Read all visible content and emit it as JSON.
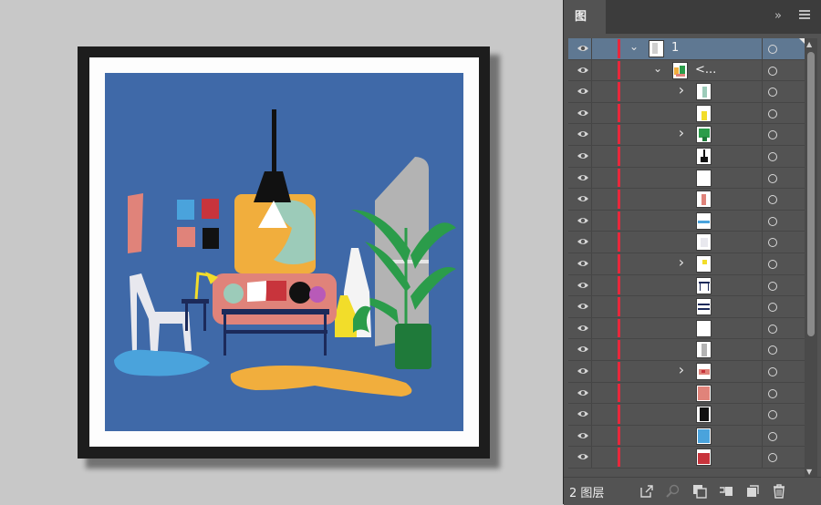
{
  "panel": {
    "tab_label": "图层",
    "layer_count_label": "2 图层",
    "colors": {
      "selected_row": "#5f7892",
      "layer_color_bar": "#e8283c",
      "panel_bg": "#535353"
    }
  },
  "layers": [
    {
      "name": "1",
      "indent": 0,
      "chevron": "down",
      "selected": true,
      "thumb": "artboard"
    },
    {
      "name": "<...",
      "indent": 1,
      "chevron": "down",
      "selected": false,
      "thumb": "group"
    },
    {
      "name": "",
      "indent": 2,
      "chevron": "right",
      "selected": false,
      "thumb": "teal-figure"
    },
    {
      "name": "",
      "indent": 2,
      "chevron": "",
      "selected": false,
      "thumb": "yellow-vase"
    },
    {
      "name": "",
      "indent": 2,
      "chevron": "right",
      "selected": false,
      "thumb": "plant"
    },
    {
      "name": "",
      "indent": 2,
      "chevron": "",
      "selected": false,
      "thumb": "lamp"
    },
    {
      "name": "",
      "indent": 2,
      "chevron": "",
      "selected": false,
      "thumb": "white-vase"
    },
    {
      "name": "",
      "indent": 2,
      "chevron": "",
      "selected": false,
      "thumb": "pink-shape"
    },
    {
      "name": "",
      "indent": 2,
      "chevron": "",
      "selected": false,
      "thumb": "blue-stroke"
    },
    {
      "name": "",
      "indent": 2,
      "chevron": "",
      "selected": false,
      "thumb": "chair"
    },
    {
      "name": "",
      "indent": 2,
      "chevron": "right",
      "selected": false,
      "thumb": "desk-lamp"
    },
    {
      "name": "",
      "indent": 2,
      "chevron": "",
      "selected": false,
      "thumb": "side-table"
    },
    {
      "name": "",
      "indent": 2,
      "chevron": "",
      "selected": false,
      "thumb": "coffee-table"
    },
    {
      "name": "",
      "indent": 2,
      "chevron": "",
      "selected": false,
      "thumb": "blank"
    },
    {
      "name": "",
      "indent": 2,
      "chevron": "",
      "selected": false,
      "thumb": "window"
    },
    {
      "name": "",
      "indent": 2,
      "chevron": "right",
      "selected": false,
      "thumb": "sofa"
    },
    {
      "name": "",
      "indent": 2,
      "chevron": "",
      "selected": false,
      "thumb": "coral-rect"
    },
    {
      "name": "",
      "indent": 2,
      "chevron": "",
      "selected": false,
      "thumb": "black-square"
    },
    {
      "name": "",
      "indent": 2,
      "chevron": "",
      "selected": false,
      "thumb": "blue-square"
    },
    {
      "name": "",
      "indent": 2,
      "chevron": "",
      "selected": false,
      "thumb": "red-square"
    }
  ],
  "footer_icons": [
    "export-icon",
    "locate-object-icon",
    "clipping-mask-icon",
    "new-sublayer-icon",
    "new-layer-icon",
    "trash-icon"
  ],
  "artwork": {
    "colors": {
      "background": "#3f69a8",
      "coral": "#e0837a",
      "orange": "#f1ae3d",
      "mint": "#9ccbb9",
      "yellow": "#f2dd2a",
      "green": "#2b9c4a",
      "dark_green": "#1f7a3a",
      "navy": "#1c2a5a",
      "light_blue": "#4aa3dc",
      "red": "#c8343c",
      "grey": "#b3b3b3"
    }
  }
}
